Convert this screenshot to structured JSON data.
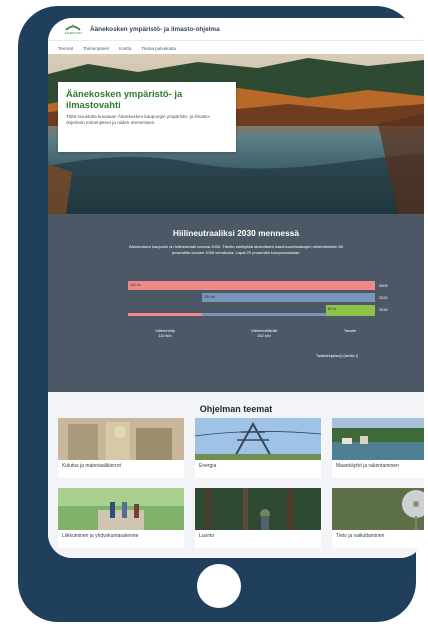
{
  "header": {
    "logo_text": "ÄÄNEKOSKI",
    "site_title": "Äänekosken ympäristö- ja ilmasto-ohjelma"
  },
  "nav": {
    "items": [
      {
        "label": "Teemat"
      },
      {
        "label": "Toimenpiteet"
      },
      {
        "label": "Kartta"
      },
      {
        "label": "Tietoa palvelusta"
      }
    ]
  },
  "hero": {
    "title": "Äänekosken ympäristö- ja ilmastovahti",
    "description": "Tältä sivustolta kuvataan Äänekosken kaupungin ympäristö- ja ilmasto-ohjelman toimenpiteet ja niiden etenemisen."
  },
  "carbon": {
    "title": "Hiilineutraaliksi 2030 mennessä",
    "description": "Äänekosken kaupunki on hiilineutraali vuonna 2030. Tämän edellyttää alueellisten kasvihuonekaasujen vähentämisen 80 prosentilla vuoden 2005 verrattuna. Lopat 20 prosenttia kompensoidaan.",
    "bars": [
      {
        "value": "240 kt",
        "year": "2005",
        "fraction": 1.0,
        "color": "#f08a8a"
      },
      {
        "value": "235 kt",
        "year": "2020",
        "fraction": 0.7,
        "color": "#7a95b8"
      },
      {
        "value": "60 kt",
        "year": "2030",
        "fraction": 0.2,
        "color": "#8bc34a"
      }
    ],
    "segments": [
      {
        "label": "Vähennetty",
        "value": "110 kt/v"
      },
      {
        "label": "Vähennettävää",
        "value": "152 kt/v"
      },
      {
        "label": "Tavoite",
        "value": ""
      }
    ],
    "source": "Tarkastelujakso(t) (tarvittu t)"
  },
  "themes": {
    "title": "Ohjelman teemat",
    "cards": [
      {
        "label": "Kulutus ja materiaalikierrot"
      },
      {
        "label": "Energia"
      },
      {
        "label": "Maankäyttö ja rakentaminen"
      },
      {
        "label": "Liikkuminen ja yhdyskuntarakenne"
      },
      {
        "label": "Luonto"
      },
      {
        "label": "Tieto ja vaikuttaminen"
      }
    ]
  },
  "colors": {
    "frame": "#1f3f5c",
    "accent_green": "#2e7d32",
    "carbon_bg": "#4c5866",
    "bar_2005": "#f08a8a",
    "bar_2020": "#7a95b8",
    "bar_2030": "#8bc34a"
  },
  "icons": {
    "logo": "aanekoski-logo-icon"
  }
}
